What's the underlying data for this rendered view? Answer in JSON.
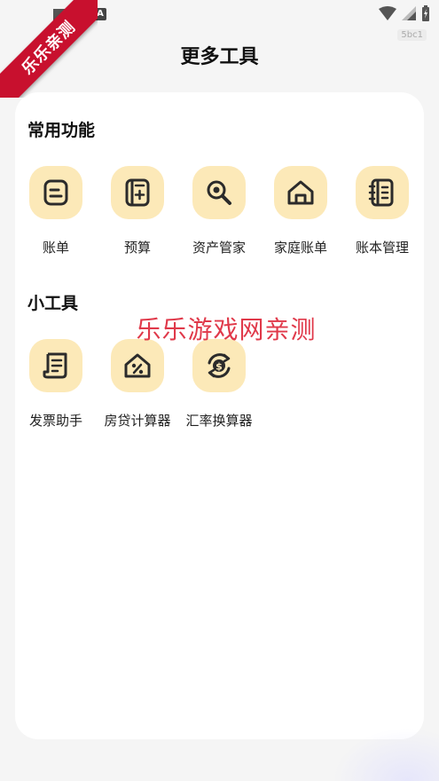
{
  "ribbon": {
    "text": "乐乐亲测"
  },
  "status_bar": {
    "badge": "A",
    "code": "5bc1"
  },
  "header": {
    "title": "更多工具"
  },
  "sections": {
    "common": {
      "title": "常用功能",
      "items": [
        {
          "label": "账单",
          "icon": "bill-icon"
        },
        {
          "label": "预算",
          "icon": "budget-icon"
        },
        {
          "label": "资产管家",
          "icon": "asset-search-icon"
        },
        {
          "label": "家庭账单",
          "icon": "home-icon"
        },
        {
          "label": "账本管理",
          "icon": "ledger-book-icon"
        }
      ]
    },
    "tools": {
      "title": "小工具",
      "items": [
        {
          "label": "发票助手",
          "icon": "invoice-icon"
        },
        {
          "label": "房贷计算器",
          "icon": "mortgage-house-percent-icon"
        },
        {
          "label": "汇率换算器",
          "icon": "currency-exchange-icon"
        }
      ]
    }
  },
  "watermark": {
    "text": "乐乐游戏网亲测"
  },
  "colors": {
    "icon_bg": "#fce9b8",
    "icon_stroke": "#2b2b2b",
    "ribbon": "#c8102e",
    "watermark": "#e0394a",
    "background": "#f5f5f5",
    "card": "#ffffff"
  }
}
